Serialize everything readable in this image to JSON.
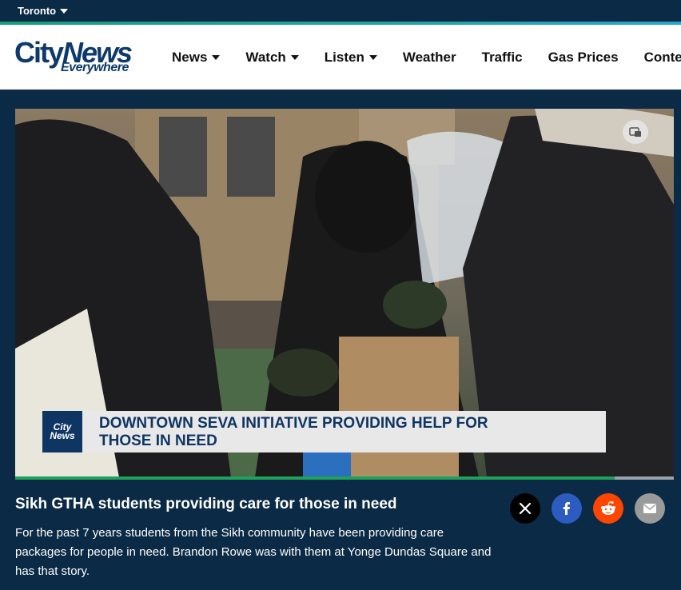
{
  "topbar": {
    "city": "Toronto"
  },
  "header": {
    "logo_main_city": "City",
    "logo_main_news": "News",
    "logo_sub": "Everywhere"
  },
  "nav": {
    "items": [
      {
        "label": "News",
        "has_dropdown": true
      },
      {
        "label": "Watch",
        "has_dropdown": true
      },
      {
        "label": "Listen",
        "has_dropdown": true
      },
      {
        "label": "Weather",
        "has_dropdown": false
      },
      {
        "label": "Traffic",
        "has_dropdown": false
      },
      {
        "label": "Gas Prices",
        "has_dropdown": false
      },
      {
        "label": "Contes",
        "has_dropdown": false
      }
    ]
  },
  "video": {
    "lower_third_logo_top": "City",
    "lower_third_logo_bottom": "News",
    "lower_third_line1": "DOWNTOWN SEVA INITIATIVE PROVIDING HELP FOR",
    "lower_third_line2": "THOSE IN NEED",
    "progress": 0.91
  },
  "article": {
    "title": "Sikh GTHA students providing care for those in need",
    "description": "For the past 7 years students from the Sikh community have been providing care packages for people in need. Brandon Rowe was with them at Yonge Dundas Square and has that story."
  },
  "share": {
    "icons": [
      "x-icon",
      "facebook-icon",
      "reddit-icon",
      "email-icon"
    ]
  },
  "colors": {
    "background": "#0b2a46",
    "brand_blue": "#0d3a6b",
    "progress_green": "#1fa15a"
  }
}
